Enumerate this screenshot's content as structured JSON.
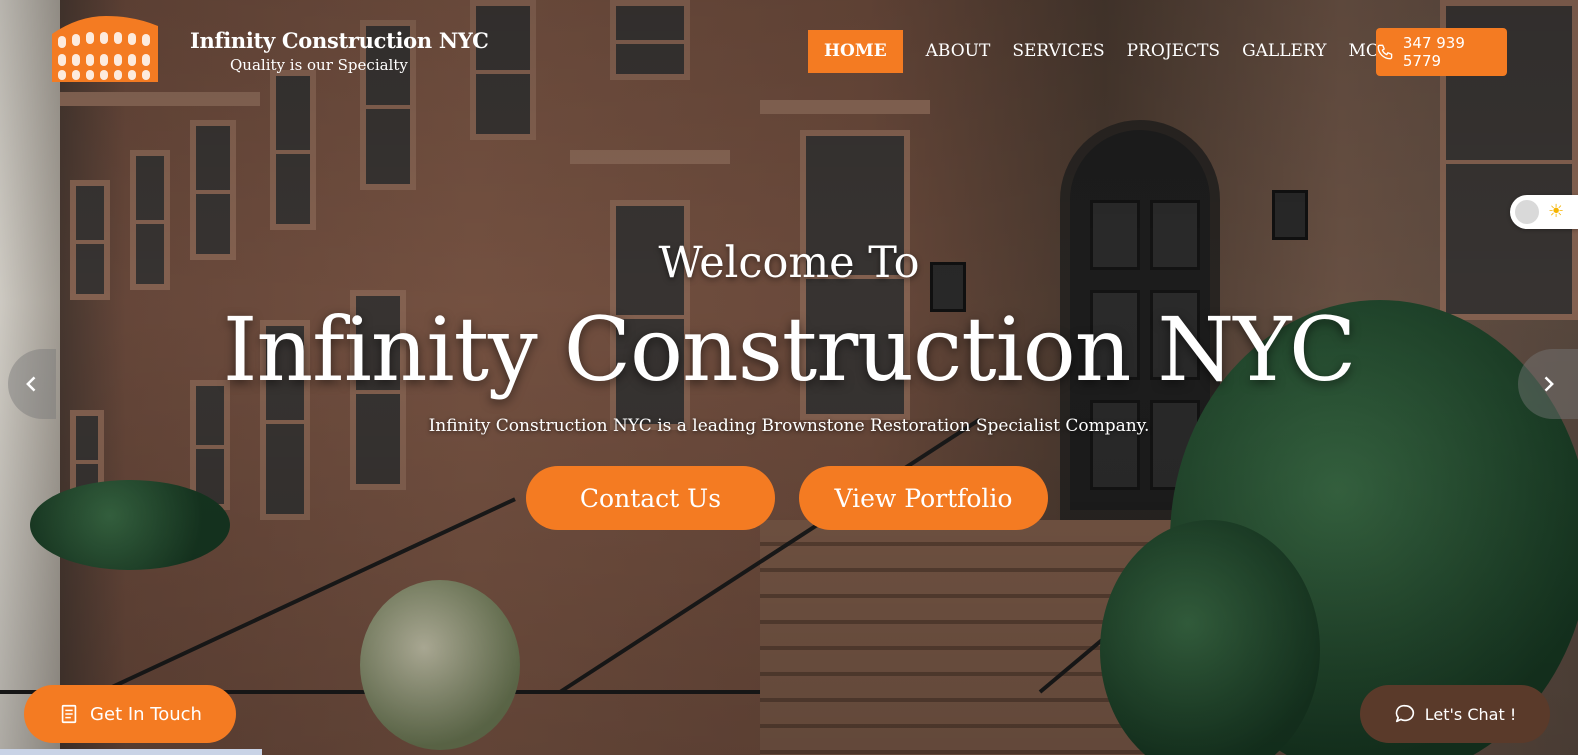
{
  "brand": {
    "name": "Infinity Construction NYC",
    "tagline": "Quality is our Specialty",
    "logo_icon": "colosseum-icon"
  },
  "nav": {
    "items": [
      {
        "label": "HOME",
        "active": true
      },
      {
        "label": "ABOUT",
        "active": false
      },
      {
        "label": "SERVICES",
        "active": false
      },
      {
        "label": "PROJECTS",
        "active": false
      },
      {
        "label": "GALLERY",
        "active": false
      },
      {
        "label": "MORE",
        "active": false
      }
    ],
    "phone": "347 939 5779",
    "phone_icon": "phone-icon"
  },
  "hero": {
    "welcome": "Welcome To",
    "headline": "Infinity Construction NYC",
    "subline": "Infinity Construction NYC is a leading Brownstone Restoration Specialist Company.",
    "primary_cta": "Contact Us",
    "secondary_cta": "View Portfolio",
    "prev_icon": "chevron-left-icon",
    "next_icon": "chevron-right-icon"
  },
  "widgets": {
    "get_in_touch": "Get In Touch",
    "get_in_touch_icon": "form-icon",
    "chat": "Let's Chat !",
    "chat_icon": "chat-bubble-icon",
    "theme_toggle_icon": "sun-icon"
  },
  "colors": {
    "accent": "#f47b22",
    "chat_bg": "#5a3a2a",
    "text_on_hero": "#ffffff"
  }
}
